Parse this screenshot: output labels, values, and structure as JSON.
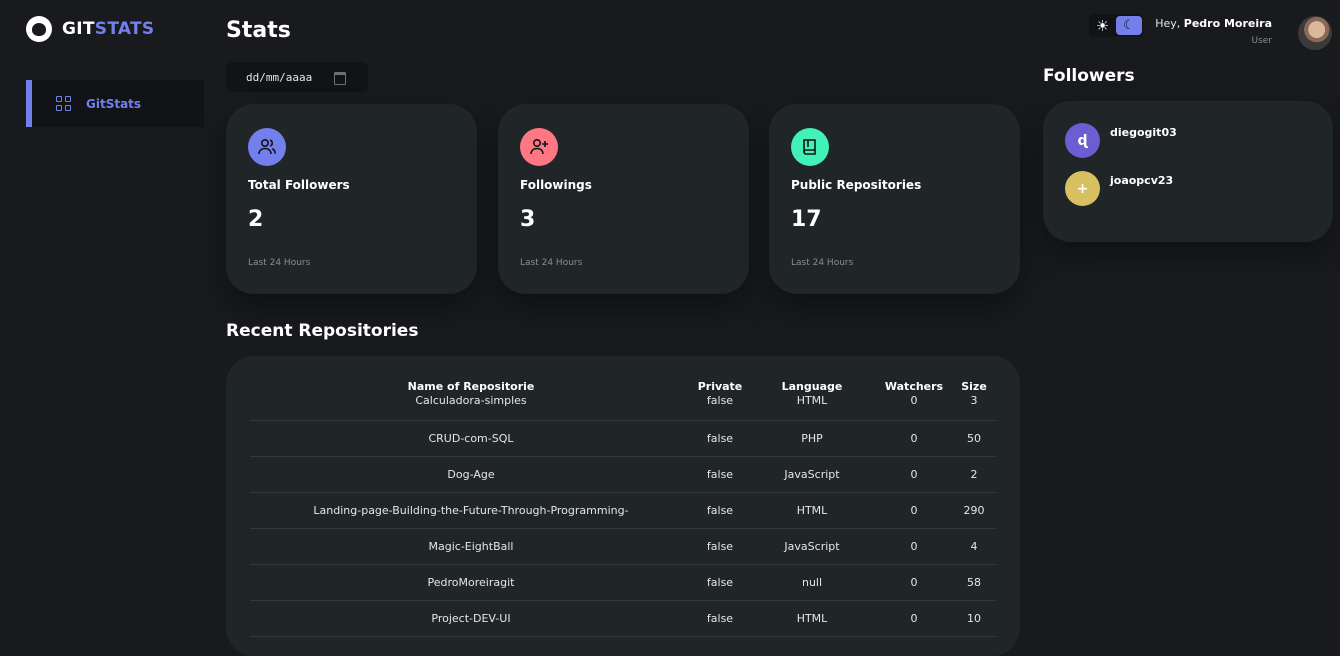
{
  "sidebar": {
    "brand_part1": "GIT",
    "brand_part2": "STATS",
    "items": [
      {
        "label": "GitStats",
        "icon": "grid-icon"
      }
    ]
  },
  "header": {
    "title": "Stats",
    "date_placeholder": "dd/mm/aaaa",
    "greeting": "Hey,",
    "user_name": "Pedro Moreira",
    "user_role": "User"
  },
  "cards": [
    {
      "title": "Total Followers",
      "value": "2",
      "footer": "Last 24 Hours",
      "color": "#7380ec",
      "icon": "users-icon"
    },
    {
      "title": "Followings",
      "value": "3",
      "footer": "Last 24 Hours",
      "color": "#ff7782",
      "icon": "user-plus-icon"
    },
    {
      "title": "Public Repositories",
      "value": "17",
      "footer": "Last 24 Hours",
      "color": "#41f1b6",
      "icon": "book-icon"
    }
  ],
  "followers": {
    "title": "Followers",
    "list": [
      {
        "name": "diegogit03",
        "avatar_glyph": "ɖ",
        "color": "#6c5dd3"
      },
      {
        "name": "joaopcv23",
        "avatar_glyph": "+",
        "color": "#d8c060"
      }
    ]
  },
  "recent": {
    "title": "Recent Repositories",
    "columns": [
      "Name of Repositorie",
      "Private",
      "Language",
      "Watchers",
      "Size"
    ],
    "rows": [
      [
        "Calculadora-simples",
        "false",
        "HTML",
        "0",
        "3"
      ],
      [
        "CRUD-com-SQL",
        "false",
        "PHP",
        "0",
        "50"
      ],
      [
        "Dog-Age",
        "false",
        "JavaScript",
        "0",
        "2"
      ],
      [
        "Landing-page-Building-the-Future-Through-Programming-",
        "false",
        "HTML",
        "0",
        "290"
      ],
      [
        "Magic-EightBall",
        "false",
        "JavaScript",
        "0",
        "4"
      ],
      [
        "PedroMoreiragit",
        "false",
        "null",
        "0",
        "58"
      ],
      [
        "Project-DEV-UI",
        "false",
        "HTML",
        "0",
        "10"
      ]
    ]
  },
  "colors": {
    "accent": "#7380ec",
    "background": "#181a1e",
    "panel": "#202528"
  }
}
